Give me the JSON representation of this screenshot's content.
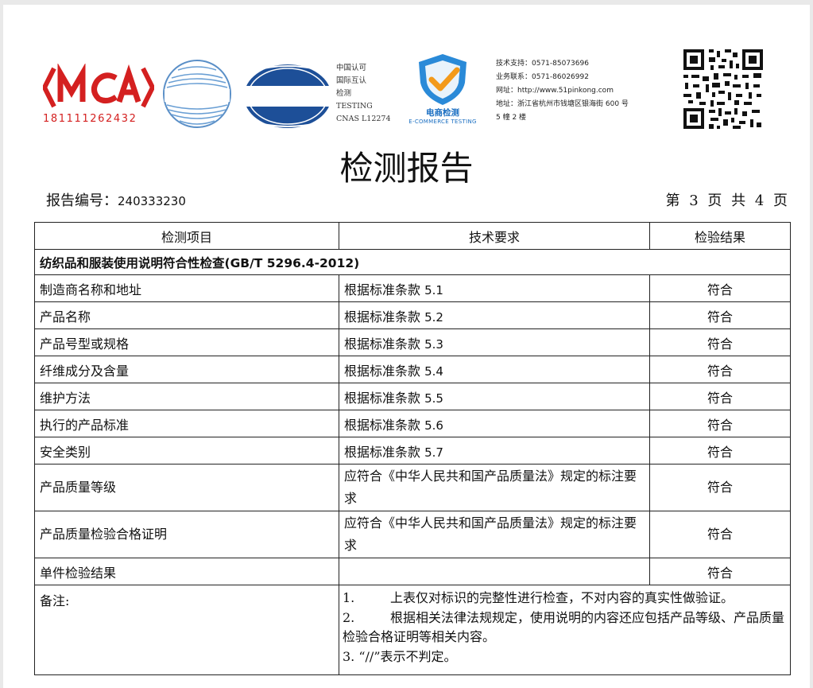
{
  "header": {
    "cma_number": "181111262432",
    "cnas_text": [
      "中国认可",
      "国际互认",
      "检测",
      "TESTING",
      "CNAS L12274"
    ],
    "ec_name": "电商检测",
    "ec_sub": "E-COMMERCE TESTING",
    "contact": [
      "技术支持：0571-85073696",
      "业务联系：0571-86026992",
      "网址：http://www.51pinkong.com",
      "地址：浙江省杭州市钱塘区银海街  600 号",
      "5 幢 2 楼"
    ]
  },
  "title": "检测报告",
  "report_no_label": "报告编号：",
  "report_no": "240333230",
  "page_indicator": "第 3 页 共 4 页",
  "table": {
    "headers": [
      "检测项目",
      "技术要求",
      "检验结果"
    ],
    "section": "纺织品和服装使用说明符合性检查(GB/T 5296.4-2012)",
    "rows": [
      {
        "item": "制造商名称和地址",
        "req_prefix": "根据标准条款 ",
        "req_num": "5.1",
        "result": "符合"
      },
      {
        "item": "产品名称",
        "req_prefix": "根据标准条款 ",
        "req_num": "5.2",
        "result": "符合"
      },
      {
        "item": "产品号型或规格",
        "req_prefix": "根据标准条款 ",
        "req_num": "5.3",
        "result": "符合"
      },
      {
        "item": "纤维成分及含量",
        "req_prefix": "根据标准条款 ",
        "req_num": "5.4",
        "result": "符合"
      },
      {
        "item": "维护方法",
        "req_prefix": "根据标准条款 ",
        "req_num": "5.5",
        "result": "符合"
      },
      {
        "item": "执行的产品标准",
        "req_prefix": "根据标准条款 ",
        "req_num": "5.6",
        "result": "符合"
      },
      {
        "item": "安全类别",
        "req_prefix": "根据标准条款 ",
        "req_num": "5.7",
        "result": "符合"
      }
    ],
    "rows2": [
      {
        "item": "产品质量等级",
        "req": "应符合《中华人民共和国产品质量法》规定的标注要求",
        "result": "符合"
      },
      {
        "item": "产品质量检验合格证明",
        "req": "应符合《中华人民共和国产品质量法》规定的标注要求",
        "result": "符合"
      }
    ],
    "single_result_label": "单件检验结果",
    "single_result": "符合",
    "notes_label": "备注:",
    "notes": [
      {
        "n": "1.",
        "text": "上表仅对标识的完整性进行检查，不对内容的真实性做验证。"
      },
      {
        "n": "2.",
        "text": "根据相关法律法规规定，使用说明的内容还应包括产品等级、产品质量检验合格证明等相关内容。"
      },
      {
        "n": "3. ",
        "text": "“//”表示不判定。"
      }
    ]
  }
}
